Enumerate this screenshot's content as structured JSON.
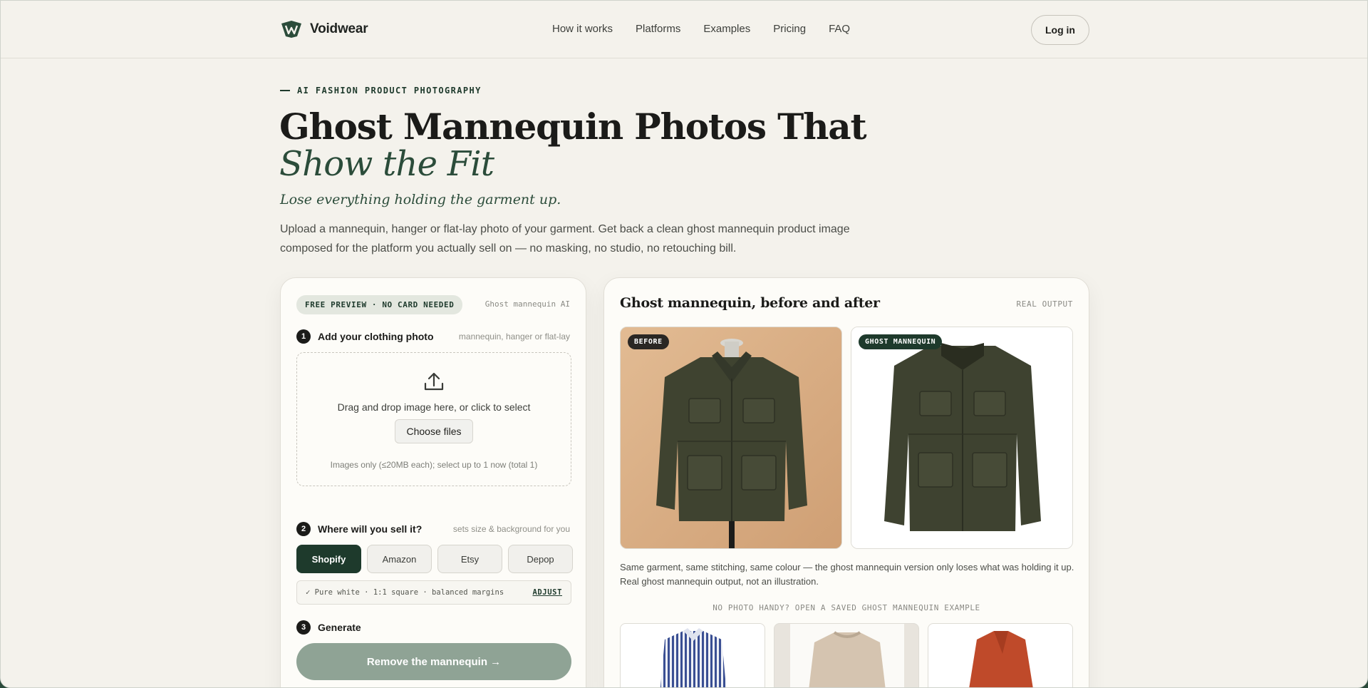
{
  "nav": {
    "brand": "Voidwear",
    "links": [
      "How it works",
      "Platforms",
      "Examples",
      "Pricing",
      "FAQ"
    ],
    "login": "Log in"
  },
  "hero": {
    "eyebrow": "AI FASHION PRODUCT PHOTOGRAPHY",
    "title_line1": "Ghost Mannequin Photos That",
    "title_line2": "Show the Fit",
    "tagline": "Lose everything holding the garment up.",
    "lead": "Upload a mannequin, hanger or flat-lay photo of your garment. Get back a clean ghost mannequin product image composed for the platform you actually sell on — no masking, no studio, no retouching bill."
  },
  "form": {
    "badge": "FREE PREVIEW · NO CARD NEEDED",
    "tag": "Ghost mannequin AI",
    "step1": {
      "num": "1",
      "title": "Add your clothing photo",
      "hint": "mannequin, hanger or flat-lay"
    },
    "dropzone": {
      "text": "Drag and drop image here, or click to select",
      "button": "Choose files",
      "note": "Images only (≤20MB each); select up to 1 now (total 1)"
    },
    "step2": {
      "num": "2",
      "title": "Where will you sell it?",
      "hint": "sets size & background for you"
    },
    "platforms": [
      "Shopify",
      "Amazon",
      "Etsy",
      "Depop"
    ],
    "selected_platform": "Shopify",
    "spec": "✓ Pure white · 1:1 square · balanced margins",
    "adjust": "ADJUST",
    "step3": {
      "num": "3",
      "title": "Generate"
    },
    "generate": "Remove the mannequin →"
  },
  "showcase": {
    "title": "Ghost mannequin, before and after",
    "tag": "REAL OUTPUT",
    "before_badge": "BEFORE",
    "after_badge": "GHOST MANNEQUIN",
    "caption": "Same garment, same stitching, same colour — the ghost mannequin version only loses what was holding it up. Real ghost mannequin output, not an illustration.",
    "examples_title": "NO PHOTO HANDY? OPEN A SAVED GHOST MANNEQUIN EXAMPLE"
  },
  "colors": {
    "accent": "#1e3a2c",
    "background": "#f4f2ec",
    "generate_disabled": "#8fa395",
    "jacket": "#3f4330",
    "before_bg": "#d9ae85"
  }
}
